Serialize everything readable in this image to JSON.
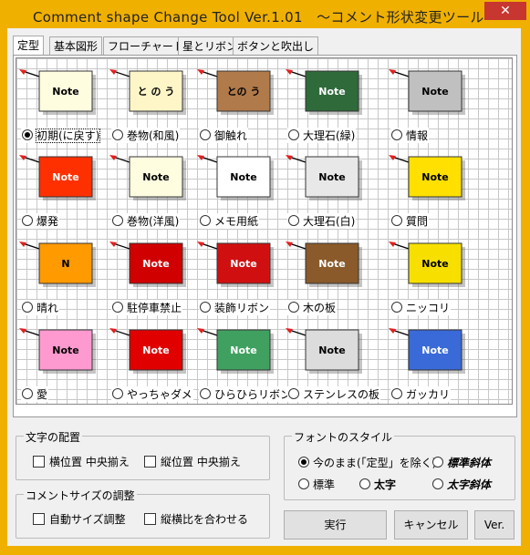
{
  "window": {
    "title": "Comment shape Change Tool Ver.1.01　～コメント形状変更ツール～",
    "close_glyph": "✕"
  },
  "tabs": [
    {
      "label": "定型",
      "active": true
    },
    {
      "label": "基本図形",
      "active": false
    },
    {
      "label": "フローチャート",
      "active": false
    },
    {
      "label": "星とリボン",
      "active": false
    },
    {
      "label": "ボタンと吹出し",
      "active": false
    }
  ],
  "shapes": [
    {
      "label": "初期(に戻す)",
      "selected": true,
      "text": "Note",
      "icon": "note-rectangle-shape"
    },
    {
      "label": "巻物(和風)",
      "selected": false,
      "text": "と の う",
      "icon": "scroll-vertical-shape"
    },
    {
      "label": "御触れ",
      "selected": false,
      "text": "との う",
      "icon": "pentagon-wood-shape"
    },
    {
      "label": "大理石(緑)",
      "selected": false,
      "text": "Note",
      "icon": "green-marble-shape"
    },
    {
      "label": "情報",
      "selected": false,
      "text": "Note",
      "icon": "information-button-shape"
    },
    {
      "label": "爆発",
      "selected": false,
      "text": "Note",
      "icon": "explosion-shape"
    },
    {
      "label": "巻物(洋風)",
      "selected": false,
      "text": "Note",
      "icon": "scroll-horizontal-shape"
    },
    {
      "label": "メモ用紙",
      "selected": false,
      "text": "Note",
      "icon": "folded-corner-shape"
    },
    {
      "label": "大理石(白)",
      "selected": false,
      "text": "Note",
      "icon": "white-marble-shape"
    },
    {
      "label": "質問",
      "selected": false,
      "text": "Note",
      "icon": "question-button-shape"
    },
    {
      "label": "晴れ",
      "selected": false,
      "text": "N",
      "icon": "sun-shape"
    },
    {
      "label": "駐停車禁止",
      "selected": false,
      "text": "Note",
      "icon": "no-parking-shape"
    },
    {
      "label": "装飾リボン",
      "selected": false,
      "text": "Note",
      "icon": "ribbon-shape"
    },
    {
      "label": "木の板",
      "selected": false,
      "text": "Note",
      "icon": "wood-board-shape"
    },
    {
      "label": "ニッコリ",
      "selected": false,
      "text": "Note",
      "icon": "smiley-shape"
    },
    {
      "label": "愛",
      "selected": false,
      "text": "Note",
      "icon": "heart-shape"
    },
    {
      "label": "やっちゃダメ",
      "selected": false,
      "text": "Note",
      "icon": "no-symbol-shape"
    },
    {
      "label": "ひらひらリボン",
      "selected": false,
      "text": "Note",
      "icon": "wave-flag-shape"
    },
    {
      "label": "ステンレスの板",
      "selected": false,
      "text": "Note",
      "icon": "stainless-plate-shape"
    },
    {
      "label": "ガッカリ",
      "selected": false,
      "text": "Note",
      "icon": "sad-face-shape"
    }
  ],
  "text_align": {
    "title": "文字の配置",
    "horizontal": "横位置 中央揃え",
    "vertical": "縦位置 中央揃え"
  },
  "size_adjust": {
    "title": "コメントサイズの調整",
    "auto": "自動サイズ調整",
    "aspect": "縦横比を合わせる"
  },
  "font_style": {
    "title": "フォントのスタイル",
    "keep": "今のまま(「定型」を除く)",
    "italic_label": "標準斜体",
    "standard": "標準",
    "bold": "太字",
    "bold_italic": "太字斜体"
  },
  "buttons": {
    "run": "実行",
    "cancel": "キャンセル",
    "ver": "Ver."
  },
  "colors": {
    "titlebar": "#f0b000",
    "close": "#c7372f",
    "arrow": "#e02020"
  }
}
